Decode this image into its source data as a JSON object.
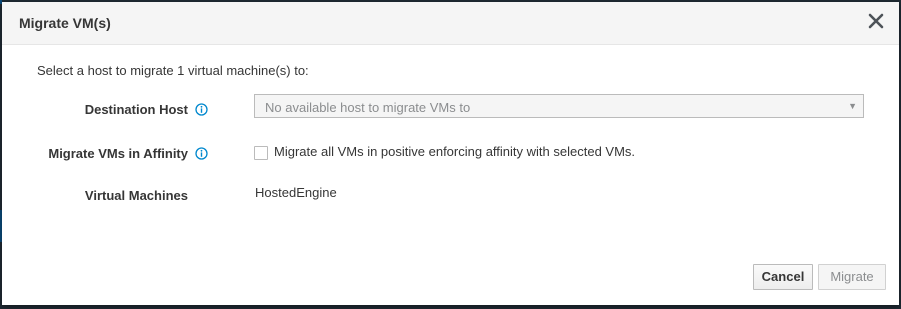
{
  "dialog": {
    "title": "Migrate VM(s)",
    "intro": "Select a host to migrate 1 virtual machine(s) to:"
  },
  "form": {
    "destination_host": {
      "label": "Destination Host",
      "selected": "No available host to migrate VMs to"
    },
    "affinity": {
      "label": "Migrate VMs in Affinity",
      "checkbox_label": "Migrate all VMs in positive enforcing affinity with selected VMs.",
      "checked": false
    },
    "virtual_machines": {
      "label": "Virtual Machines",
      "value": "HostedEngine"
    }
  },
  "buttons": {
    "cancel": "Cancel",
    "migrate": "Migrate"
  },
  "colors": {
    "accent": "#0088ce",
    "text": "#363636",
    "muted": "#8b8d8f"
  },
  "icons": {
    "close": "close-icon",
    "info": "info-icon",
    "caret": "caret-down-icon"
  }
}
